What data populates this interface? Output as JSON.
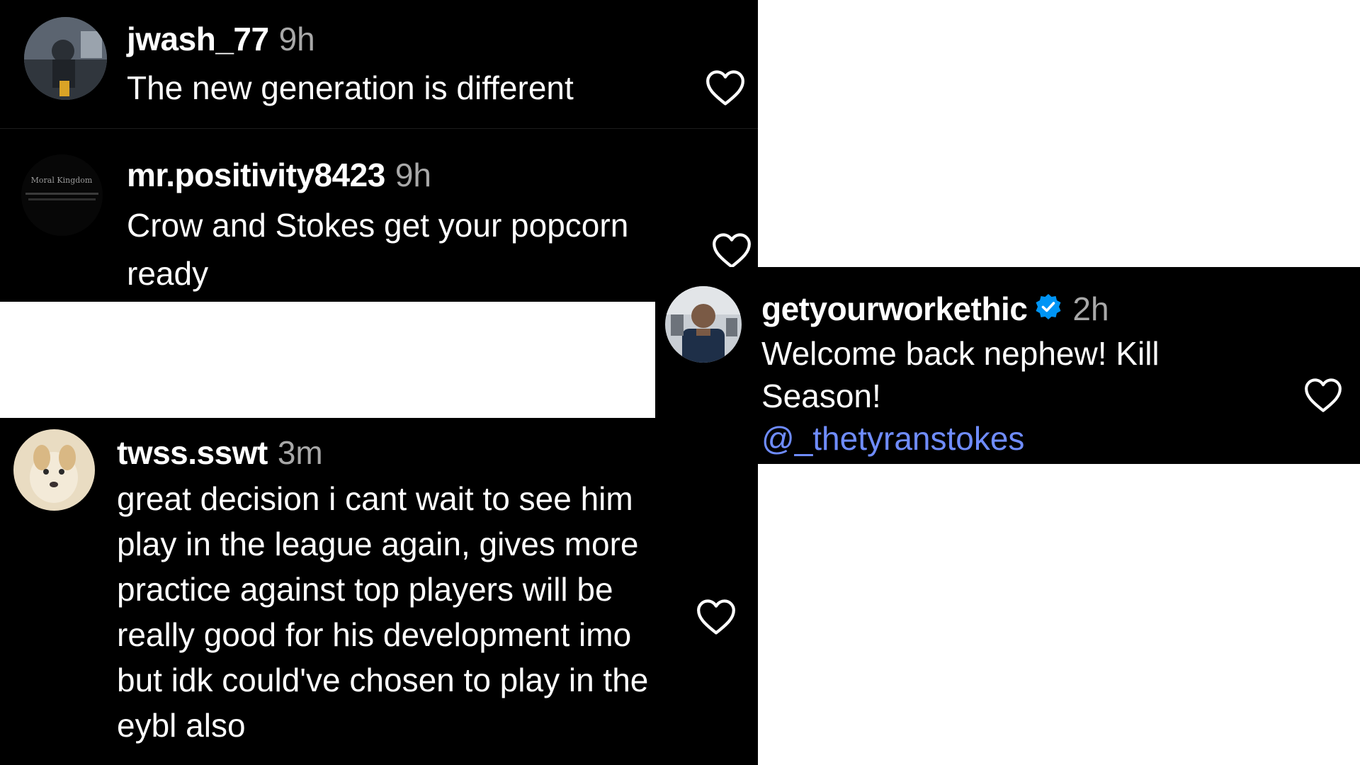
{
  "colors": {
    "background": "#000000",
    "username": "#ffffff",
    "timestamp": "#a8a8a8",
    "mention": "#6f8cff",
    "verified_badge": "#0095f6"
  },
  "comments": [
    {
      "username": "jwash_77",
      "time": "9h",
      "text": "The new generation is different",
      "avatar_icon": "avatar-photo"
    },
    {
      "username": "mr.positivity8423",
      "time": "9h",
      "text": "Crow and Stokes get your popcorn ready",
      "avatar_icon": "avatar-dark-text",
      "avatar_caption": "Moral Kingdom"
    },
    {
      "username": "getyourworkethic",
      "time": "2h",
      "verified": true,
      "text": "Welcome back nephew! Kill Season!",
      "mention": "@_thetyranstokes",
      "avatar_icon": "avatar-photo"
    },
    {
      "username": "twss.sswt",
      "time": "3m",
      "text": "great decision i cant wait to see him play in the league again, gives more practice against top players will be really good for his development imo but idk could've chosen to play in the eybl also",
      "avatar_icon": "avatar-dog"
    }
  ],
  "icons": {
    "like": "heart-outline-icon",
    "verified": "verified-badge-icon"
  }
}
